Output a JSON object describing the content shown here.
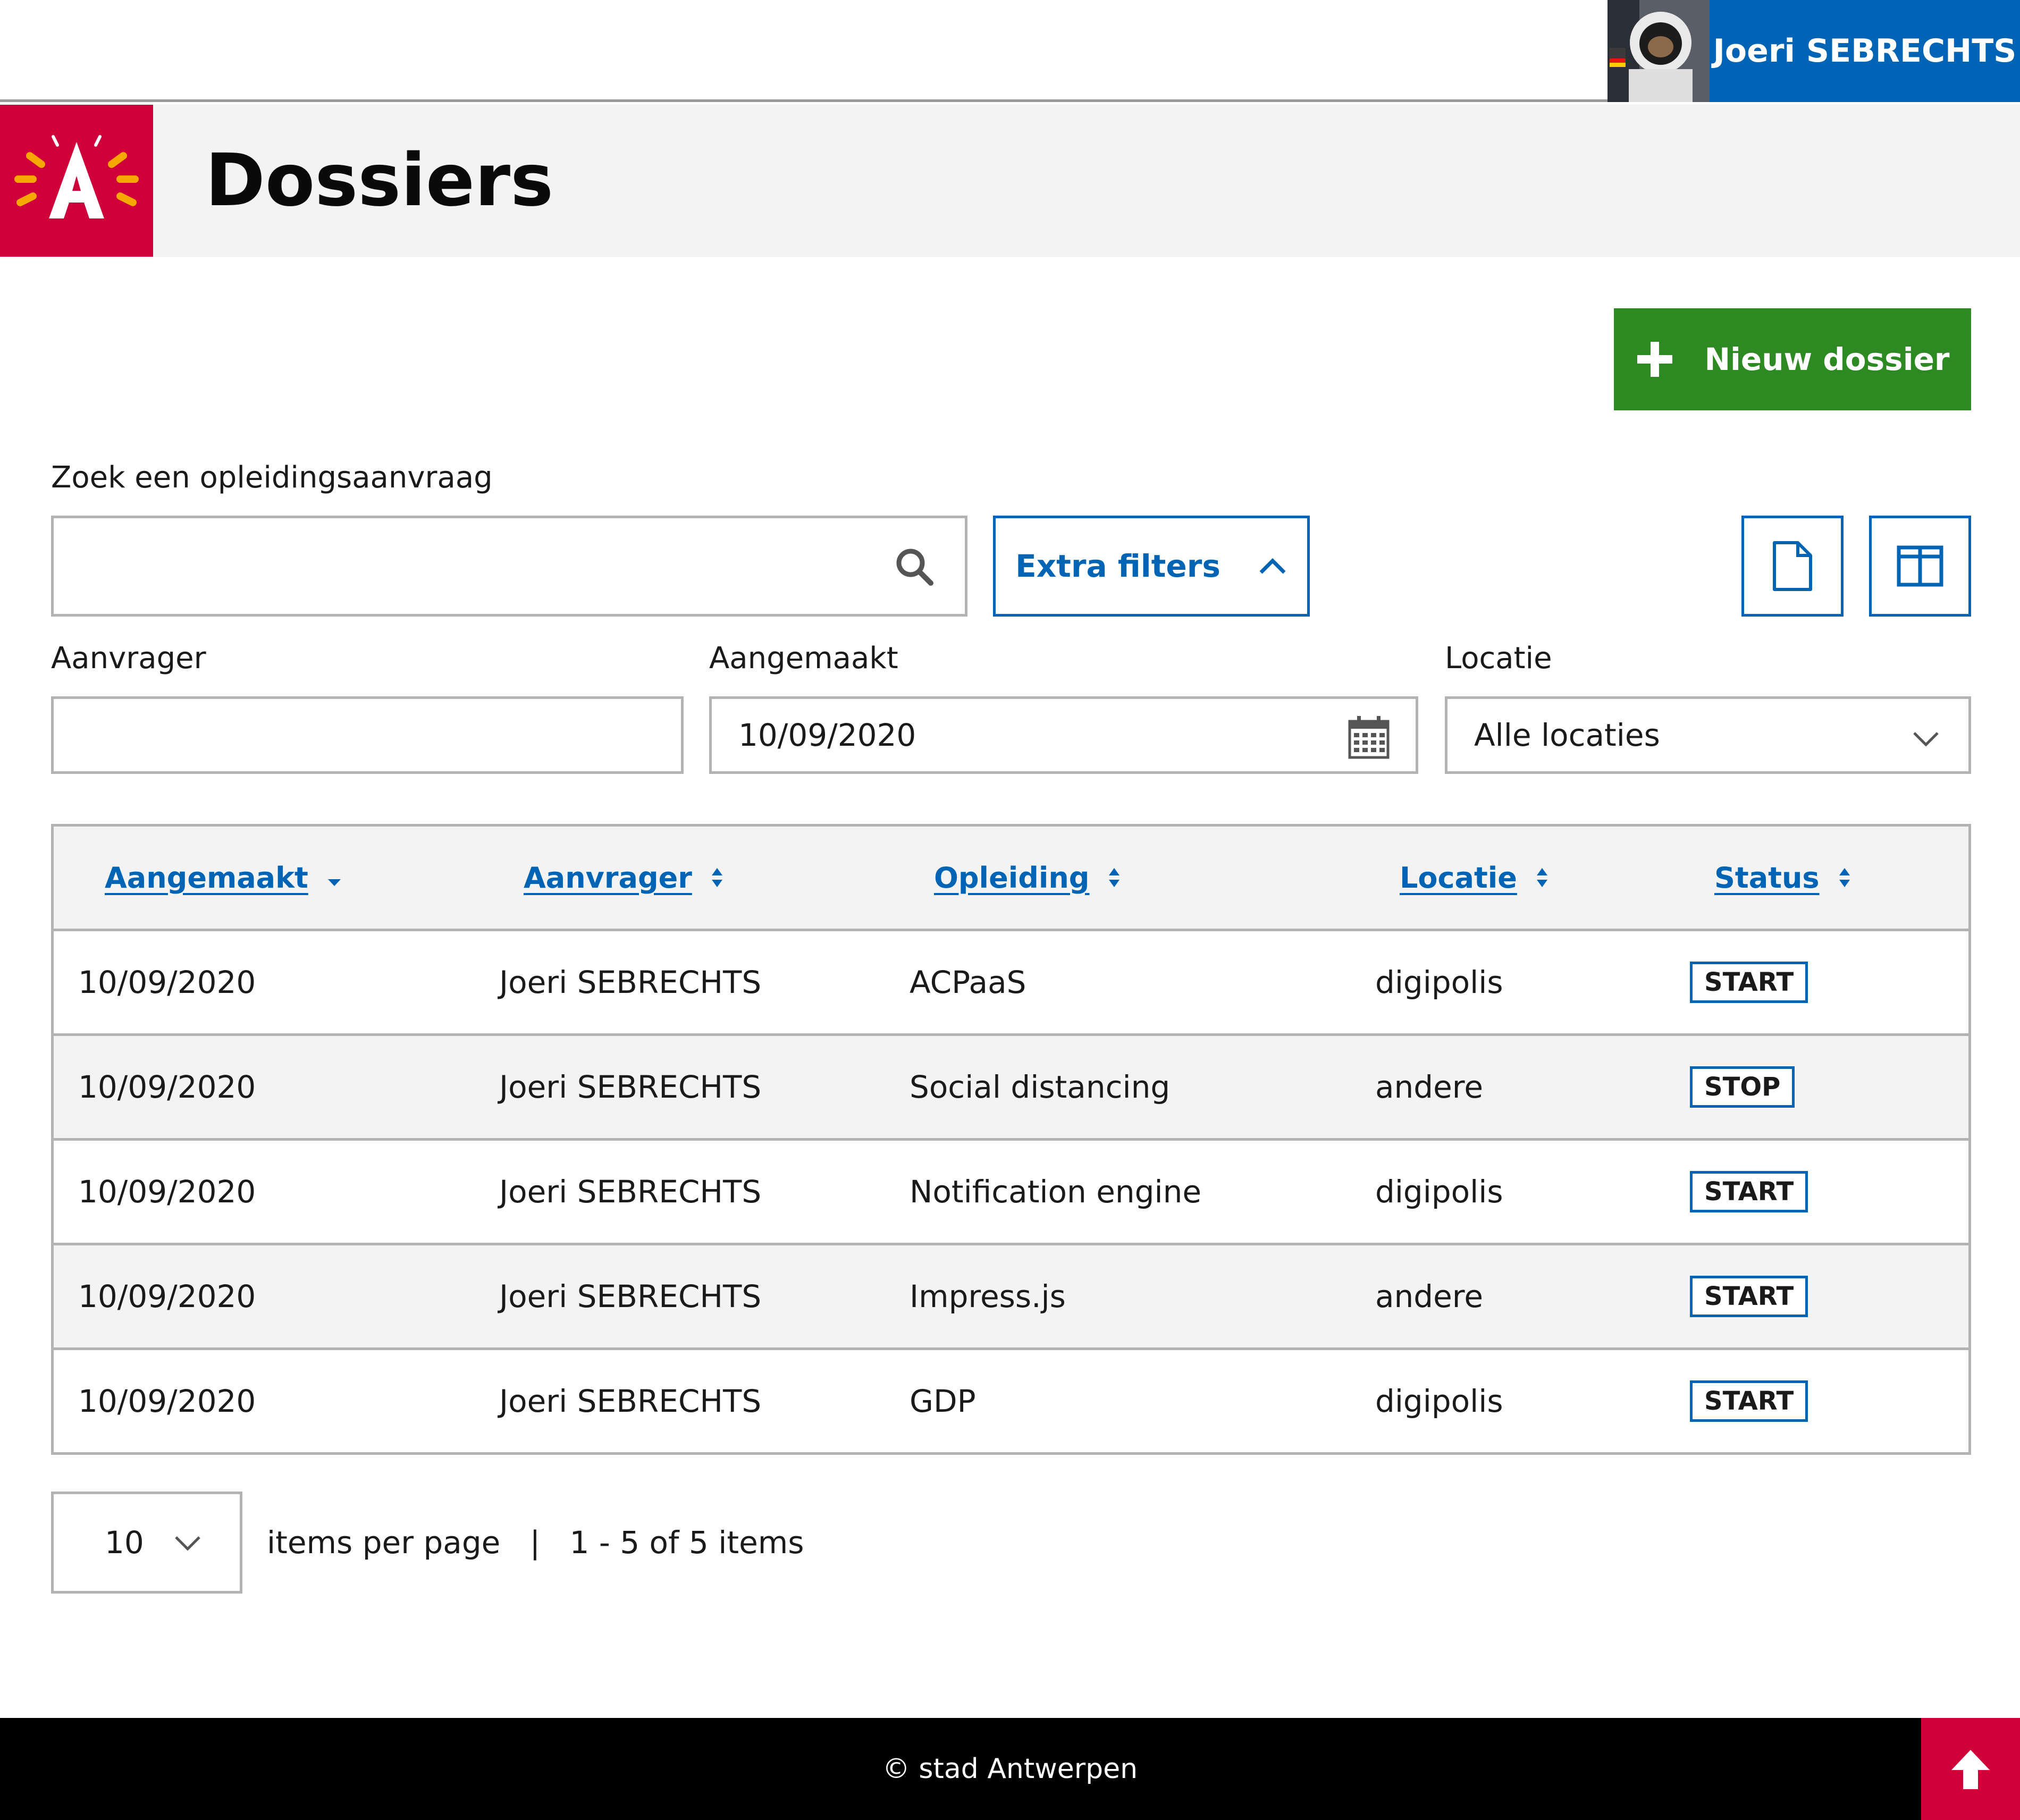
{
  "user": {
    "name": "Joeri SEBRECHTS"
  },
  "header": {
    "title": "Dossiers"
  },
  "actions": {
    "new_label": "Nieuw dossier"
  },
  "search": {
    "label": "Zoek een opleidingsaanvraag",
    "value": "",
    "placeholder": "",
    "filters_label": "Extra filters"
  },
  "filters": {
    "aanvrager": {
      "label": "Aanvrager",
      "value": ""
    },
    "aangemaakt": {
      "label": "Aangemaakt",
      "value": "10/09/2020"
    },
    "locatie": {
      "label": "Locatie",
      "value": "Alle locaties"
    }
  },
  "table": {
    "columns": [
      "Aangemaakt",
      "Aanvrager",
      "Opleiding",
      "Locatie",
      "Status"
    ],
    "rows": [
      [
        "10/09/2020",
        "Joeri SEBRECHTS",
        "ACPaaS",
        "digipolis",
        "START"
      ],
      [
        "10/09/2020",
        "Joeri SEBRECHTS",
        "Social distancing",
        "andere",
        "STOP"
      ],
      [
        "10/09/2020",
        "Joeri SEBRECHTS",
        "Notification engine",
        "digipolis",
        "START"
      ],
      [
        "10/09/2020",
        "Joeri SEBRECHTS",
        "Impress.js",
        "andere",
        "START"
      ],
      [
        "10/09/2020",
        "Joeri SEBRECHTS",
        "GDP",
        "digipolis",
        "START"
      ]
    ]
  },
  "pagination": {
    "per_page": "10",
    "text": "items per page   |   1 - 5 of 5 items"
  },
  "footer": {
    "text": "© stad Antwerpen"
  },
  "colors": {
    "brand_red": "#cf0039",
    "primary_blue": "#0064b4",
    "success_green": "#2d8a22"
  },
  "icons": [
    "user-avatar",
    "city-logo",
    "plus-icon",
    "search-icon",
    "chevron-up-icon",
    "document-icon",
    "columns-icon",
    "calendar-icon",
    "chevron-down-icon",
    "sort-icon",
    "arrow-up-icon"
  ]
}
